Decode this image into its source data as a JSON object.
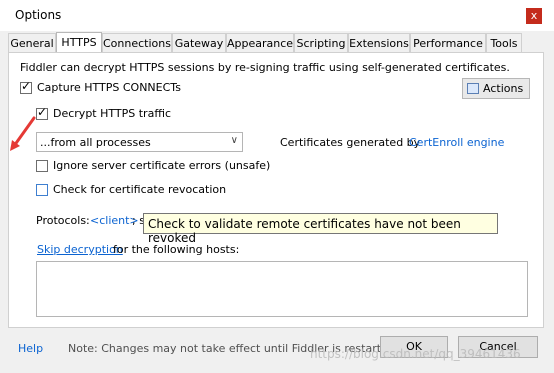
{
  "window": {
    "title": "Options",
    "close_label": "x"
  },
  "tabs": [
    {
      "label": "General"
    },
    {
      "label": "HTTPS"
    },
    {
      "label": "Connections"
    },
    {
      "label": "Gateway"
    },
    {
      "label": "Appearance"
    },
    {
      "label": "Scripting"
    },
    {
      "label": "Extensions"
    },
    {
      "label": "Performance"
    },
    {
      "label": "Tools"
    }
  ],
  "https": {
    "intro": "Fiddler can decrypt HTTPS sessions by re-signing traffic using self-generated certificates.",
    "capture_label": "Capture HTTPS CONNECTs",
    "capture_checked": true,
    "actions_label": "Actions",
    "decrypt_label": "Decrypt HTTPS traffic",
    "decrypt_checked": true,
    "process_filter_value": "...from all processes",
    "cert_generated_prefix": "Certificates generated by ",
    "cert_engine_link": "CertEnroll engine",
    "ignore_errors_label": "Ignore server certificate errors (unsafe)",
    "ignore_errors_checked": false,
    "revocation_label": "Check for certificate revocation",
    "revocation_checked": false,
    "protocols_prefix": "Protocols: ",
    "protocols_link": "<client>",
    "protocols_suffix": "; s",
    "tooltip": "Check to validate remote certificates have not been revoked",
    "skip_link": "Skip decryption",
    "skip_suffix": " for the following hosts:",
    "hosts_value": ""
  },
  "footer": {
    "help_label": "Help",
    "note": "Note: Changes may not take effect until Fiddler is restarted.",
    "ok_label": "OK",
    "cancel_label": "Cancel"
  },
  "watermark": "https://blog.csdn.net/qq_39461436",
  "colors": {
    "link": "#0b63d1",
    "close": "#c42b1c",
    "tooltip_bg": "#ffffe1",
    "annotation": "#e53935"
  }
}
